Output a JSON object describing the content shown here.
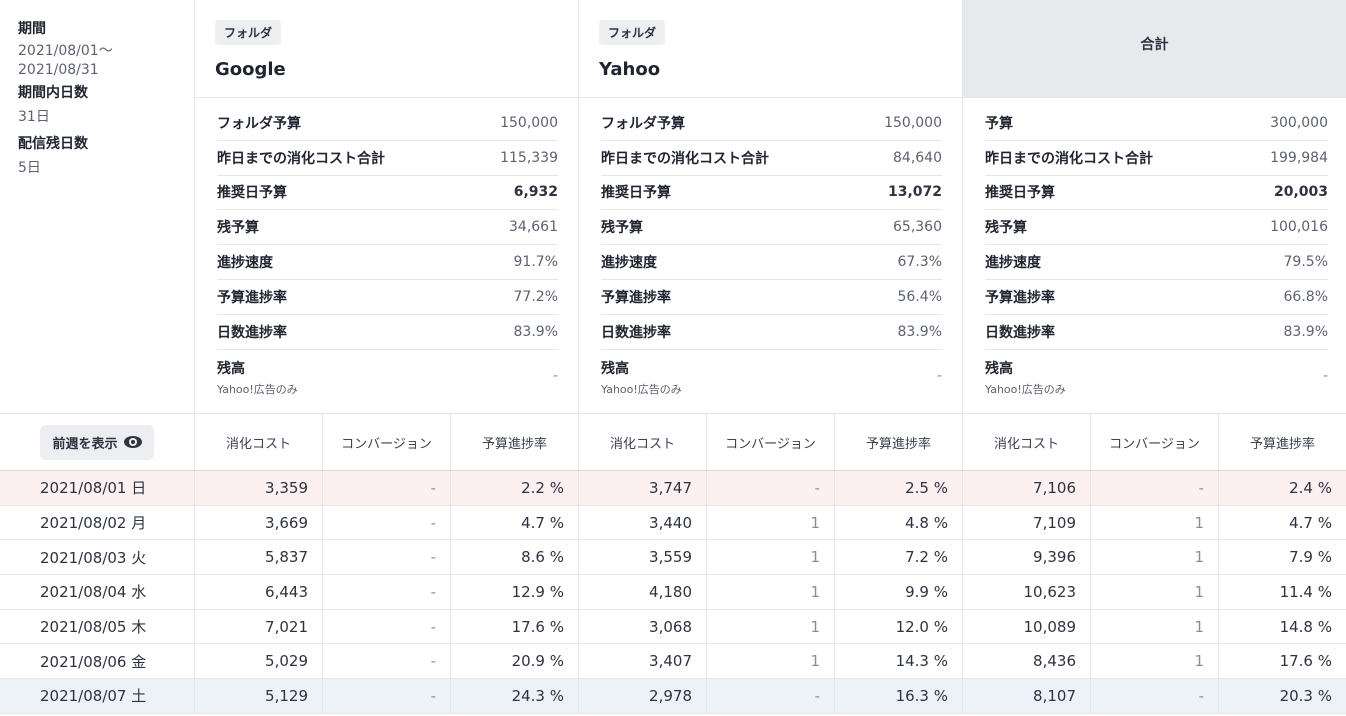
{
  "period": {
    "label": "期間",
    "start": "2021/08/01〜",
    "end": "2021/08/31",
    "days_label": "期間内日数",
    "days_value": "31日",
    "remaining_label": "配信残日数",
    "remaining_value": "5日"
  },
  "folders": [
    {
      "tag": "フォルダ",
      "name": "Google",
      "metrics": [
        {
          "label": "フォルダ予算",
          "value": "150,000"
        },
        {
          "label": "昨日までの消化コスト合計",
          "value": "115,339"
        },
        {
          "label": "推奨日予算",
          "value": "6,932"
        },
        {
          "label": "残予算",
          "value": "34,661"
        },
        {
          "label": "進捗速度",
          "value": "91.7%"
        },
        {
          "label": "予算進捗率",
          "value": "77.2%"
        },
        {
          "label": "日数進捗率",
          "value": "83.9%"
        }
      ],
      "balance": {
        "label": "残高",
        "sub": "Yahoo!広告のみ",
        "value": "-"
      }
    },
    {
      "tag": "フォルダ",
      "name": "Yahoo",
      "metrics": [
        {
          "label": "フォルダ予算",
          "value": "150,000"
        },
        {
          "label": "昨日までの消化コスト合計",
          "value": "84,640"
        },
        {
          "label": "推奨日予算",
          "value": "13,072"
        },
        {
          "label": "残予算",
          "value": "65,360"
        },
        {
          "label": "進捗速度",
          "value": "67.3%"
        },
        {
          "label": "予算進捗率",
          "value": "56.4%"
        },
        {
          "label": "日数進捗率",
          "value": "83.9%"
        }
      ],
      "balance": {
        "label": "残高",
        "sub": "Yahoo!広告のみ",
        "value": "-"
      }
    }
  ],
  "total": {
    "name": "合計",
    "metrics": [
      {
        "label": "予算",
        "value": "300,000"
      },
      {
        "label": "昨日までの消化コスト合計",
        "value": "199,984"
      },
      {
        "label": "推奨日予算",
        "value": "20,003"
      },
      {
        "label": "残予算",
        "value": "100,016"
      },
      {
        "label": "進捗速度",
        "value": "79.5%"
      },
      {
        "label": "予算進捗率",
        "value": "66.8%"
      },
      {
        "label": "日数進捗率",
        "value": "83.9%"
      }
    ],
    "balance": {
      "label": "残高",
      "sub": "Yahoo!広告のみ",
      "value": "-"
    }
  },
  "table": {
    "prev_week_button": "前週を表示",
    "headers": [
      "消化コスト",
      "コンバージョン",
      "予算進捗率",
      "消化コスト",
      "コンバージョン",
      "予算進捗率",
      "消化コスト",
      "コンバージョン",
      "予算進捗率"
    ],
    "rows": [
      {
        "date": "2021/08/01 日",
        "type": "sun",
        "cells": [
          "3,359",
          "-",
          "2.2 %",
          "3,747",
          "-",
          "2.5 %",
          "7,106",
          "-",
          "2.4 %"
        ]
      },
      {
        "date": "2021/08/02 月",
        "type": "",
        "cells": [
          "3,669",
          "-",
          "4.7 %",
          "3,440",
          "1",
          "4.8 %",
          "7,109",
          "1",
          "4.7 %"
        ]
      },
      {
        "date": "2021/08/03 火",
        "type": "",
        "cells": [
          "5,837",
          "-",
          "8.6 %",
          "3,559",
          "1",
          "7.2 %",
          "9,396",
          "1",
          "7.9 %"
        ]
      },
      {
        "date": "2021/08/04 水",
        "type": "",
        "cells": [
          "6,443",
          "-",
          "12.9 %",
          "4,180",
          "1",
          "9.9 %",
          "10,623",
          "1",
          "11.4 %"
        ]
      },
      {
        "date": "2021/08/05 木",
        "type": "",
        "cells": [
          "7,021",
          "-",
          "17.6 %",
          "3,068",
          "1",
          "12.0 %",
          "10,089",
          "1",
          "14.8 %"
        ]
      },
      {
        "date": "2021/08/06 金",
        "type": "",
        "cells": [
          "5,029",
          "-",
          "20.9 %",
          "3,407",
          "1",
          "14.3 %",
          "8,436",
          "1",
          "17.6 %"
        ]
      },
      {
        "date": "2021/08/07 土",
        "type": "sat",
        "cells": [
          "5,129",
          "-",
          "24.3 %",
          "2,978",
          "-",
          "16.3 %",
          "8,107",
          "-",
          "20.3 %"
        ]
      }
    ]
  }
}
